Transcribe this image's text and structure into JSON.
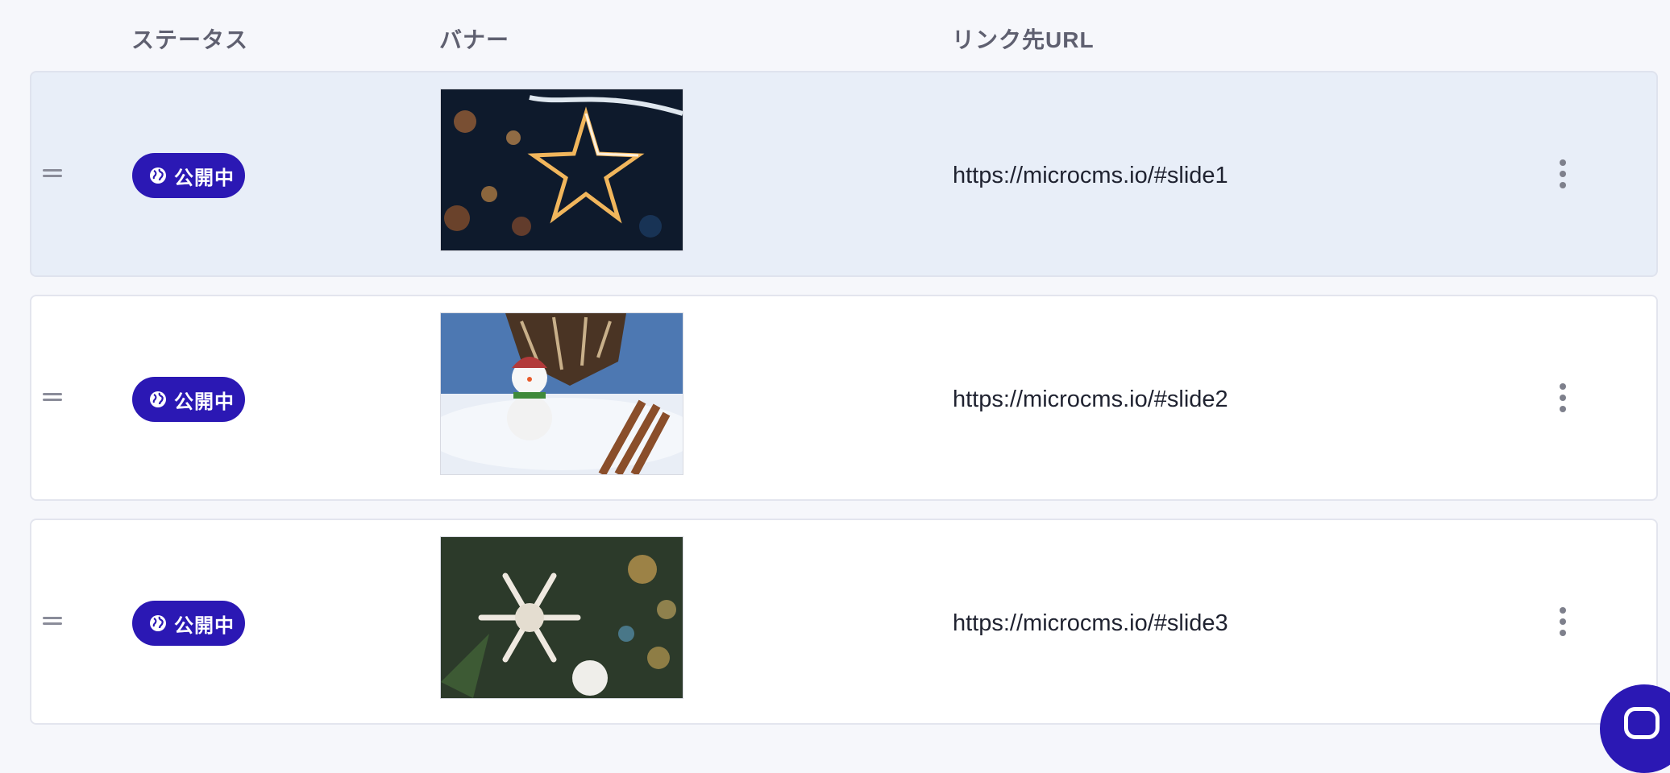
{
  "columns": {
    "status": "ステータス",
    "banner": "バナー",
    "url": "リンク先URL"
  },
  "rows": [
    {
      "status": "公開中",
      "banner": "star-light-snow",
      "url": "https://microcms.io/#slide1",
      "selected": true
    },
    {
      "status": "公開中",
      "banner": "snowman-pinecone",
      "url": "https://microcms.io/#slide2",
      "selected": false
    },
    {
      "status": "公開中",
      "banner": "snowflake-ornament",
      "url": "https://microcms.io/#slide3",
      "selected": false
    }
  ],
  "icons": {
    "drag": "drag-handle-icon",
    "status": "globe-icon",
    "menu": "more-vertical-icon",
    "chat": "chat-bubble-icon"
  },
  "colors": {
    "badge": "#2b18b4",
    "selected_row": "#e8eef8",
    "background": "#f6f7fb"
  }
}
